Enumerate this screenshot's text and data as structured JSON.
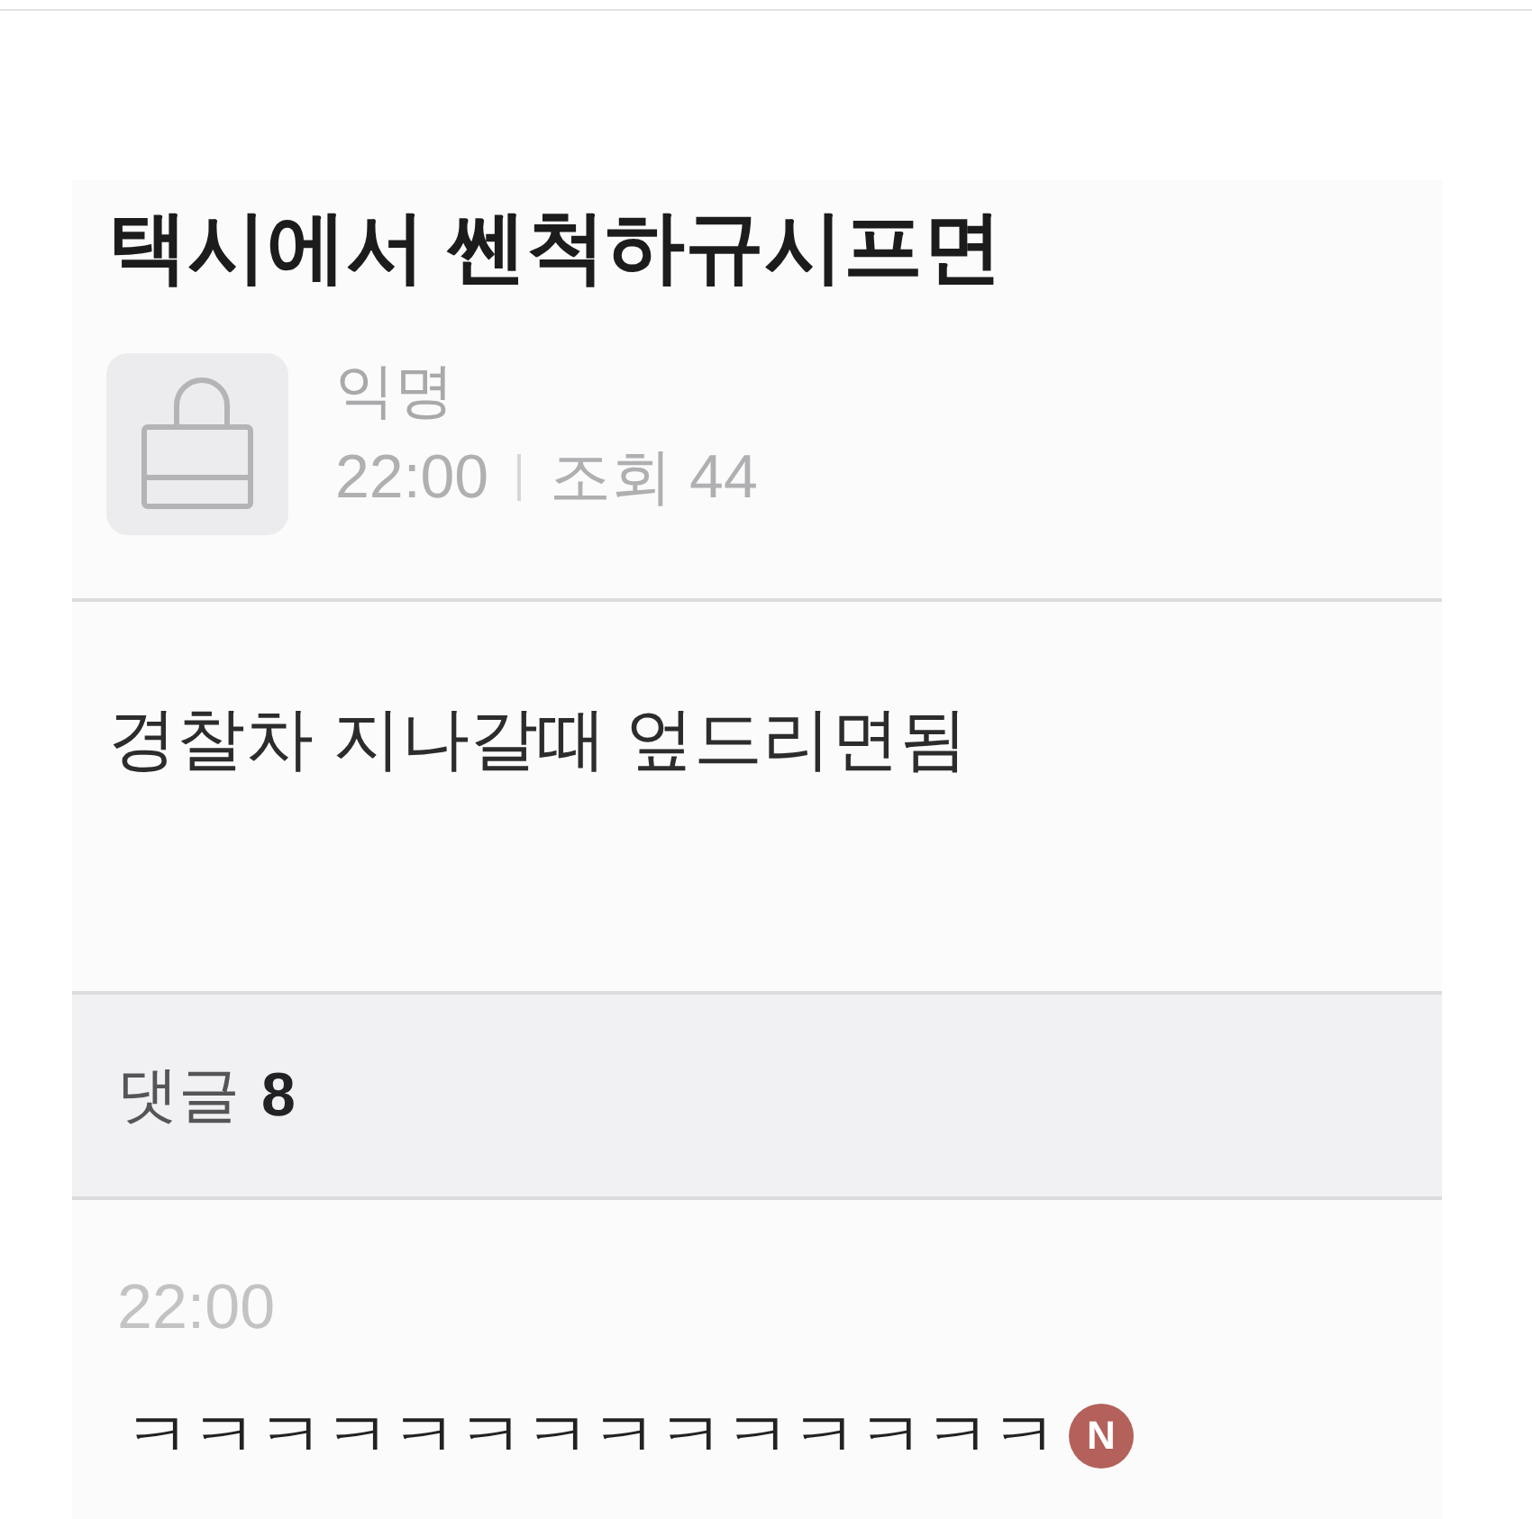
{
  "post": {
    "title": "택시에서 쎈척하규시프면",
    "author": "익명",
    "time": "22:00",
    "views": "조회 44",
    "body": "경찰차 지나갈때 엎드리면됨"
  },
  "comments_header": {
    "label": "댓글",
    "count": "8"
  },
  "comments": [
    {
      "time": "22:00",
      "text": "ㅋㅋㅋㅋㅋㅋㅋㅋㅋㅋㅋㅋㅋㅋ",
      "badge": "N"
    }
  ]
}
